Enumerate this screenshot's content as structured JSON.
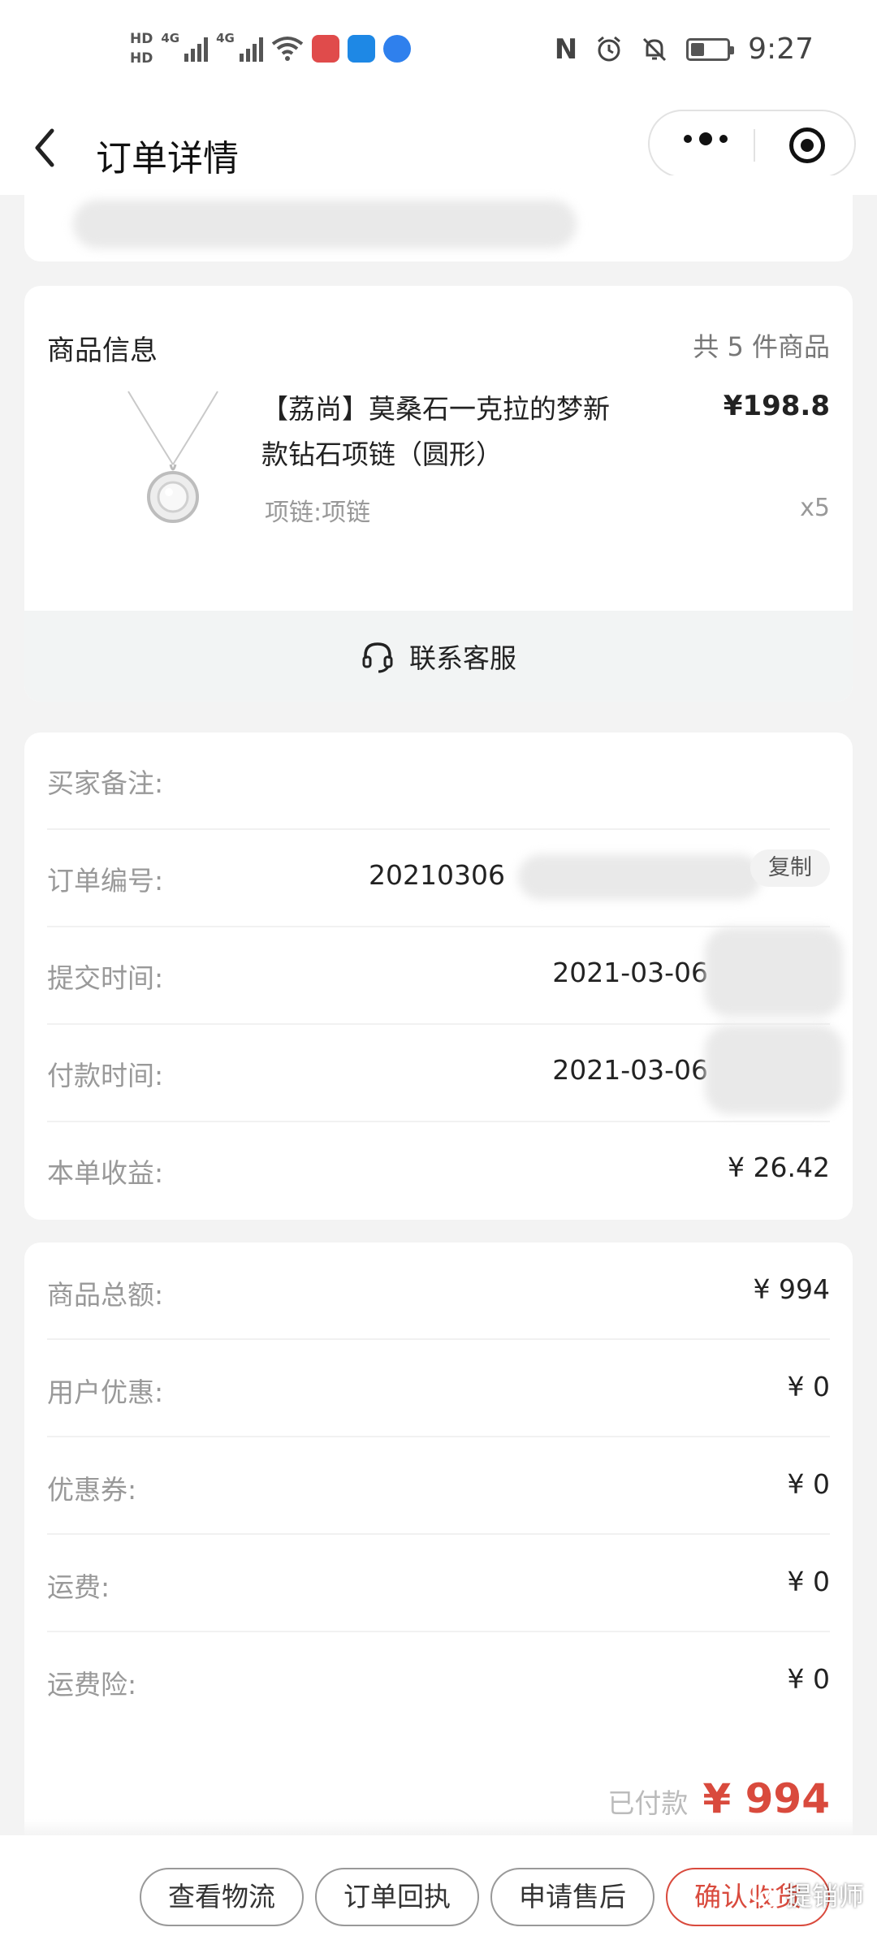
{
  "status_bar": {
    "hd1": "HD",
    "hd2": "HD",
    "net1": "4G",
    "net2": "4G",
    "nfc_icon": "N",
    "time": "9:27"
  },
  "nav": {
    "title": "订单详情"
  },
  "goods": {
    "header": "商品信息",
    "count_text": "共 5 件商品",
    "product_name": "【荔尚】莫桑石一克拉的梦新款钻石项链（圆形）",
    "price": "¥198.8",
    "spec": "项链:项链",
    "qty": "x5",
    "service_label": "联系客服"
  },
  "order_info": {
    "rows": [
      {
        "label": "买家备注:",
        "value": ""
      },
      {
        "label": "订单编号:",
        "value": "20210306"
      },
      {
        "label": "提交时间:",
        "value": "2021-03-06"
      },
      {
        "label": "付款时间:",
        "value": "2021-03-06"
      },
      {
        "label": "本单收益:",
        "value": "¥ 26.42"
      }
    ],
    "copy_label": "复制"
  },
  "amounts": {
    "rows": [
      {
        "label": "商品总额:",
        "value": "¥ 994"
      },
      {
        "label": "用户优惠:",
        "value": "¥ 0"
      },
      {
        "label": "优惠券:",
        "value": "¥ 0"
      },
      {
        "label": "运费:",
        "value": "¥ 0"
      },
      {
        "label": "运费险:",
        "value": "¥ 0"
      }
    ],
    "paid_label": "已付款",
    "paid_value": "¥ 994"
  },
  "actions": {
    "logistics": "查看物流",
    "receipt": "订单回执",
    "after_sales": "申请售后",
    "confirm": "确认收货"
  },
  "watermark": {
    "text": "提销师"
  },
  "colors": {
    "accent": "#d94a3d",
    "background": "#f3f3f3"
  }
}
